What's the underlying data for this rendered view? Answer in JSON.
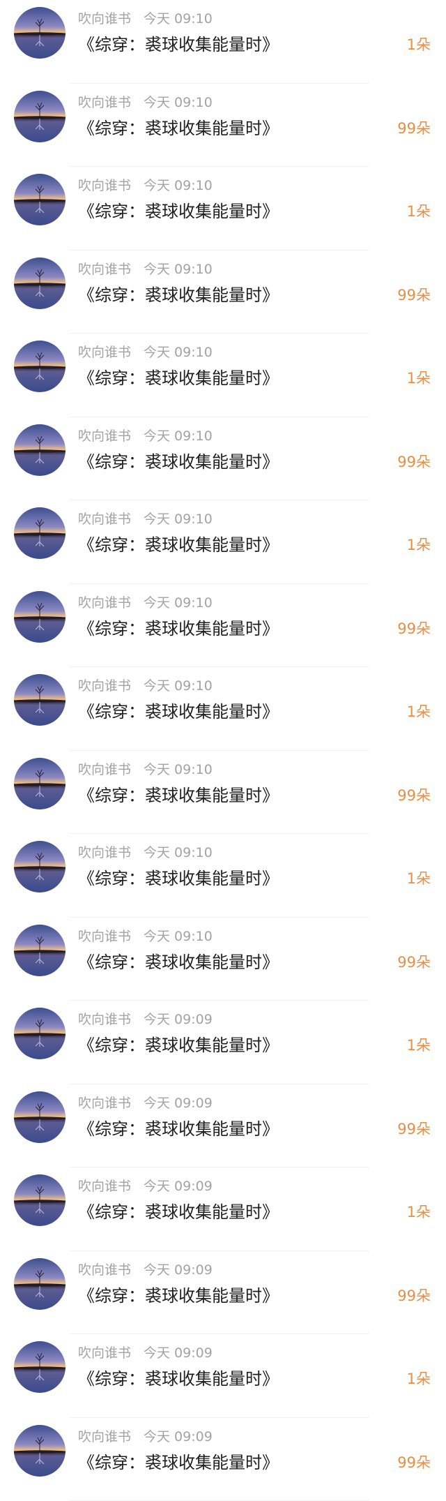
{
  "gift_list": {
    "rows": [
      {
        "sender": "吹向谁书",
        "time": "今天 09:10",
        "book_title": "《综穿：裘球收集能量时》",
        "amount": "1朵"
      },
      {
        "sender": "吹向谁书",
        "time": "今天 09:10",
        "book_title": "《综穿：裘球收集能量时》",
        "amount": "99朵"
      },
      {
        "sender": "吹向谁书",
        "time": "今天 09:10",
        "book_title": "《综穿：裘球收集能量时》",
        "amount": "1朵"
      },
      {
        "sender": "吹向谁书",
        "time": "今天 09:10",
        "book_title": "《综穿：裘球收集能量时》",
        "amount": "99朵"
      },
      {
        "sender": "吹向谁书",
        "time": "今天 09:10",
        "book_title": "《综穿：裘球收集能量时》",
        "amount": "1朵"
      },
      {
        "sender": "吹向谁书",
        "time": "今天 09:10",
        "book_title": "《综穿：裘球收集能量时》",
        "amount": "99朵"
      },
      {
        "sender": "吹向谁书",
        "time": "今天 09:10",
        "book_title": "《综穿：裘球收集能量时》",
        "amount": "1朵"
      },
      {
        "sender": "吹向谁书",
        "time": "今天 09:10",
        "book_title": "《综穿：裘球收集能量时》",
        "amount": "99朵"
      },
      {
        "sender": "吹向谁书",
        "time": "今天 09:10",
        "book_title": "《综穿：裘球收集能量时》",
        "amount": "1朵"
      },
      {
        "sender": "吹向谁书",
        "time": "今天 09:10",
        "book_title": "《综穿：裘球收集能量时》",
        "amount": "99朵"
      },
      {
        "sender": "吹向谁书",
        "time": "今天 09:10",
        "book_title": "《综穿：裘球收集能量时》",
        "amount": "1朵"
      },
      {
        "sender": "吹向谁书",
        "time": "今天 09:10",
        "book_title": "《综穿：裘球收集能量时》",
        "amount": "99朵"
      },
      {
        "sender": "吹向谁书",
        "time": "今天 09:09",
        "book_title": "《综穿：裘球收集能量时》",
        "amount": "1朵"
      },
      {
        "sender": "吹向谁书",
        "time": "今天 09:09",
        "book_title": "《综穿：裘球收集能量时》",
        "amount": "99朵"
      },
      {
        "sender": "吹向谁书",
        "time": "今天 09:09",
        "book_title": "《综穿：裘球收集能量时》",
        "amount": "1朵"
      },
      {
        "sender": "吹向谁书",
        "time": "今天 09:09",
        "book_title": "《综穿：裘球收集能量时》",
        "amount": "99朵"
      },
      {
        "sender": "吹向谁书",
        "time": "今天 09:09",
        "book_title": "《综穿：裘球收集能量时》",
        "amount": "1朵"
      },
      {
        "sender": "吹向谁书",
        "time": "今天 09:09",
        "book_title": "《综穿：裘球收集能量时》",
        "amount": "99朵"
      }
    ]
  },
  "colors": {
    "amount": "#e88f43",
    "meta": "#a3a3a3",
    "title": "#1f1f1f"
  },
  "avatar": {
    "icon": "landscape-avatar-icon"
  }
}
